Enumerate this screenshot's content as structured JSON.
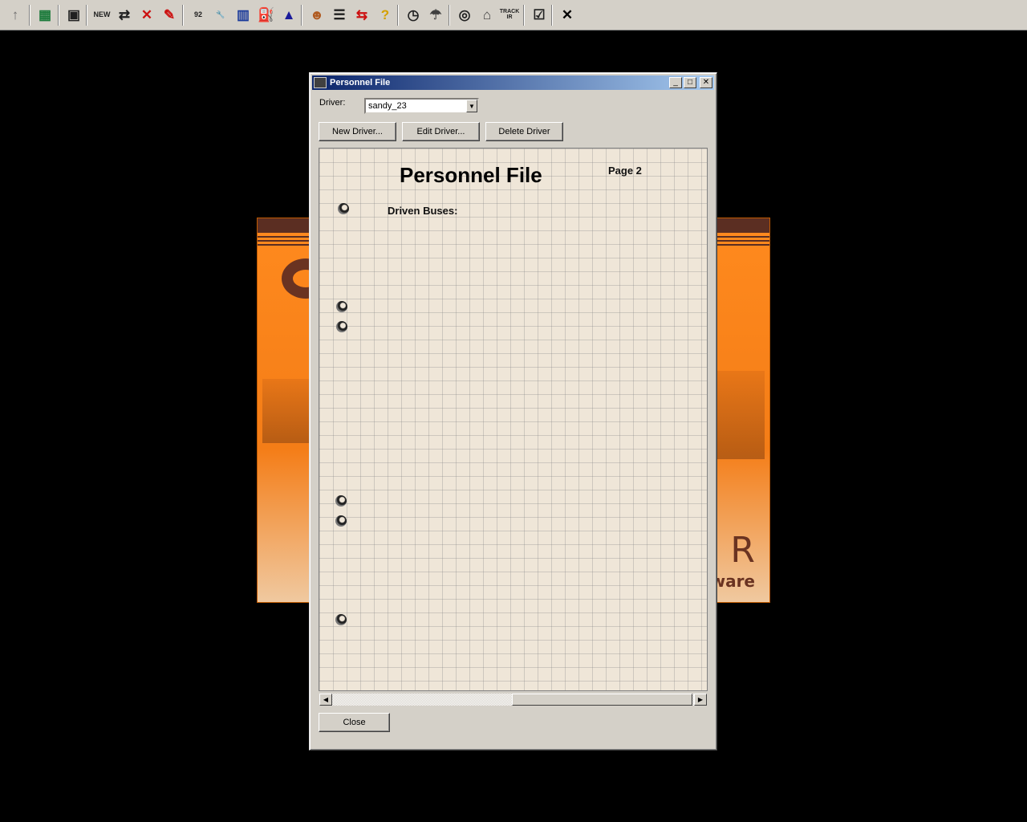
{
  "toolbar": {
    "items": [
      {
        "name": "up-arrow-icon",
        "glyph": "↑",
        "color": "#707070"
      },
      {
        "name": "map-icon",
        "glyph": "▦",
        "color": "#1a7a3a"
      },
      {
        "name": "save-icon",
        "glyph": "▣",
        "color": "#202020"
      },
      {
        "name": "new-bus-icon",
        "glyph": "NEW",
        "color": "#202020"
      },
      {
        "name": "bus-route-icon",
        "glyph": "⇄",
        "color": "#202020"
      },
      {
        "name": "delete-bus-icon",
        "glyph": "✕",
        "color": "#cc1111"
      },
      {
        "name": "red-pen-icon",
        "glyph": "✎",
        "color": "#cc1111"
      },
      {
        "name": "year-calendar-icon",
        "glyph": "92",
        "color": "#202020"
      },
      {
        "name": "wrench-icon",
        "glyph": "🔧",
        "color": "#404040"
      },
      {
        "name": "depot-icon",
        "glyph": "▥",
        "color": "#1a3a9a"
      },
      {
        "name": "fuel-pump-icon",
        "glyph": "⛽",
        "color": "#202020"
      },
      {
        "name": "driver-cap-icon",
        "glyph": "▲",
        "color": "#1a1a9a"
      },
      {
        "name": "driver-face-icon",
        "glyph": "☻",
        "color": "#b05a20"
      },
      {
        "name": "document-icon",
        "glyph": "☰",
        "color": "#202020"
      },
      {
        "name": "exchange-icon",
        "glyph": "⇆",
        "color": "#cc1111"
      },
      {
        "name": "help-icon",
        "glyph": "?",
        "color": "#d4a000"
      },
      {
        "name": "clock-icon",
        "glyph": "◷",
        "color": "#202020"
      },
      {
        "name": "weather-icon",
        "glyph": "☂",
        "color": "#404040"
      },
      {
        "name": "steering-wheel-icon",
        "glyph": "◎",
        "color": "#202020"
      },
      {
        "name": "mouse-icon",
        "glyph": "⌂",
        "color": "#404040"
      },
      {
        "name": "track-ir-icon",
        "glyph": "TRACK IR",
        "color": "#202020"
      },
      {
        "name": "settings-list-icon",
        "glyph": "☑",
        "color": "#202020"
      },
      {
        "name": "exit-icon",
        "glyph": "✕",
        "color": "#000000"
      }
    ]
  },
  "splash": {
    "brand_text": "ftware",
    "brand_letter": "R"
  },
  "window": {
    "title": "Personnel File",
    "driver_label": "Driver:",
    "driver_value": "sandy_23",
    "buttons": {
      "new_driver": "New Driver...",
      "edit_driver": "Edit Driver...",
      "delete_driver": "Delete Driver",
      "close": "Close"
    },
    "paper": {
      "title": "Personnel File",
      "page": "Page 2",
      "section": "Driven Buses:"
    }
  }
}
